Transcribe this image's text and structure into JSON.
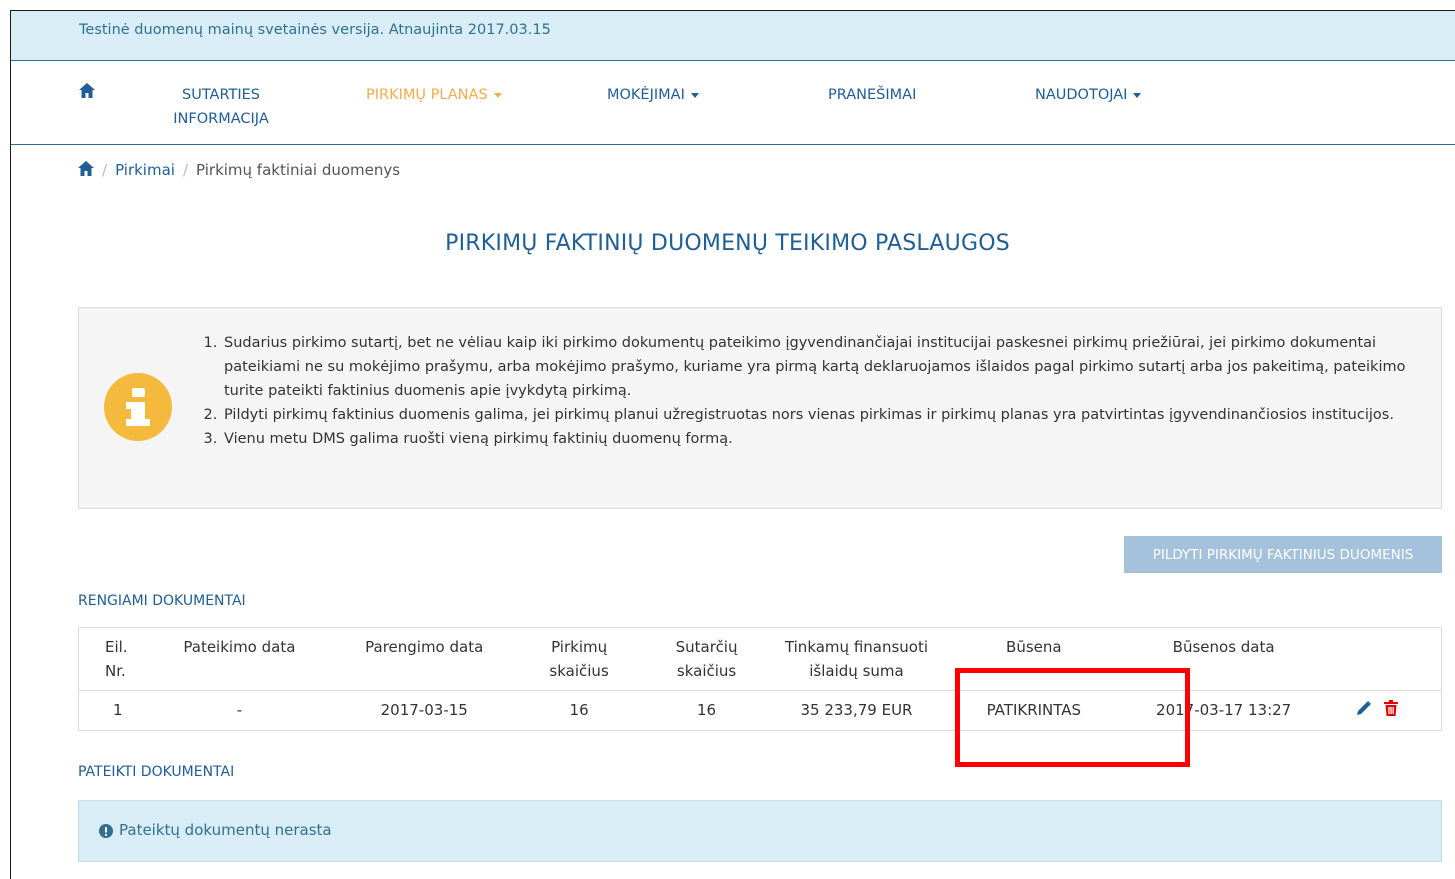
{
  "banner": {
    "text": "Testinė duomenų mainų svetainės versija. Atnaujinta 2017.03.15"
  },
  "nav": {
    "items": [
      {
        "label_line1": "SUTARTIES",
        "label_line2": "INFORMACIJA"
      },
      {
        "label": "PIRKIMŲ PLANAS"
      },
      {
        "label": "MOKĖJIMAI"
      },
      {
        "label": "PRANEŠIMAI"
      },
      {
        "label": "NAUDOTOJAI"
      }
    ],
    "active_color": "#f0ad4e",
    "link_color": "#1f5e96"
  },
  "breadcrumb": {
    "sep": "/",
    "link": "Pirkimai",
    "current": "Pirkimų faktiniai duomenys"
  },
  "page": {
    "title": "PIRKIMŲ FAKTINIŲ DUOMENŲ TEIKIMO PASLAUGOS"
  },
  "info": {
    "items": [
      "Sudarius pirkimo sutartį, bet ne vėliau kaip iki pirkimo dokumentų pateikimo įgyvendinančiajai institucijai paskesnei pirkimų priežiūrai, jei pirkimo dokumentai pateikiami ne su mokėjimo prašymu, arba mokėjimo prašymo, kuriame yra pirmą kartą deklaruojamos išlaidos pagal pirkimo sutartį arba jos pakeitimą, pateikimo turite pateikti faktinius duomenis apie įvykdytą pirkimą.",
      "Pildyti pirkimų faktinius duomenis galima, jei pirkimų planui užregistruotas nors vienas pirkimas ir pirkimų planas yra patvirtintas įgyvendinančiosios institucijos.",
      "Vienu metu DMS galima ruošti vieną pirkimų faktinių duomenų formą."
    ]
  },
  "actions": {
    "fill_button": "PILDYTI PIRKIMŲ FAKTINIUS DUOMENIS"
  },
  "prepared": {
    "title": "RENGIAMI DOKUMENTAI",
    "columns": [
      "Eil. Nr.",
      "Pateikimo data",
      "Parengimo data",
      "Pirkimų skaičius",
      "Sutarčių skaičius",
      "Tinkamų finansuoti išlaidų suma",
      "Būsena",
      "Būsenos data"
    ],
    "rows": [
      {
        "nr": "1",
        "submitted": "-",
        "prepared": "2017-03-15",
        "purchases": "16",
        "contracts": "16",
        "amount": "35 233,79 EUR",
        "status": "PATIKRINTAS",
        "status_date": "2017-03-17 13:27"
      }
    ]
  },
  "submitted": {
    "title": "PATEIKTI DOKUMENTAI",
    "empty": "Pateiktų dokumentų nerasta"
  }
}
